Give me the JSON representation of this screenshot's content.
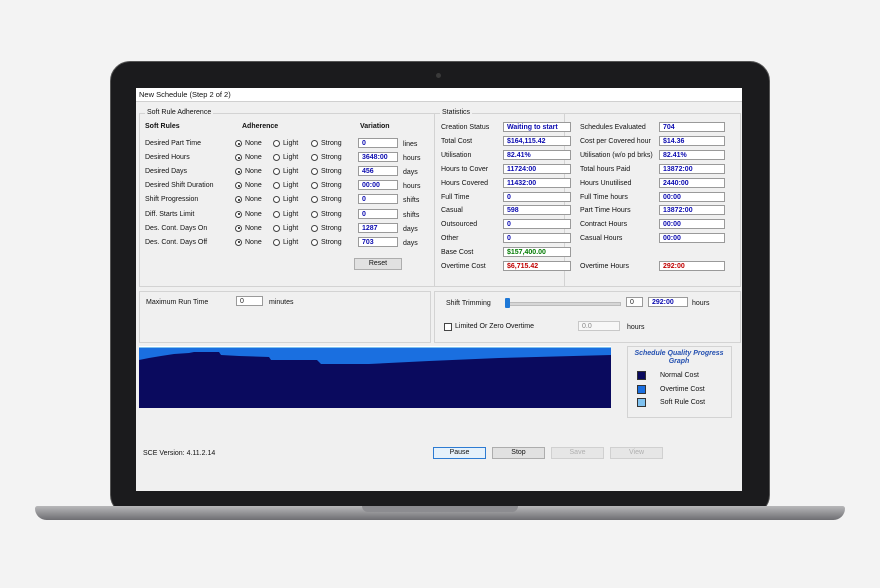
{
  "window": {
    "title": "New Schedule (Step 2 of 2)"
  },
  "soft_rules": {
    "group_title": "Soft Rule Adherence",
    "col_rules": "Soft Rules",
    "col_adherence": "Adherence",
    "col_variation": "Variation",
    "options": [
      "None",
      "Light",
      "Strong"
    ],
    "rows": [
      {
        "label": "Desired Part Time",
        "value": "0",
        "unit": "lines"
      },
      {
        "label": "Desired Hours",
        "value": "3648:00",
        "unit": "hours"
      },
      {
        "label": "Desired Days",
        "value": "456",
        "unit": "days"
      },
      {
        "label": "Desired Shift Duration",
        "value": "00:00",
        "unit": "hours"
      },
      {
        "label": "Shift Progression",
        "value": "0",
        "unit": "shifts"
      },
      {
        "label": "Diff. Starts Limit",
        "value": "0",
        "unit": "shifts"
      },
      {
        "label": "Des. Cont. Days On",
        "value": "1287",
        "unit": "days"
      },
      {
        "label": "Des. Cont. Days Off",
        "value": "703",
        "unit": "days"
      }
    ],
    "reset_label": "Reset"
  },
  "statistics": {
    "group_title": "Statistics",
    "left": [
      {
        "label": "Creation Status",
        "value": "Waiting to start"
      },
      {
        "label": "Total Cost",
        "value": "$164,115.42"
      },
      {
        "label": "Utilisation",
        "value": "82.41%"
      },
      {
        "label": "Hours to Cover",
        "value": "11724:00"
      },
      {
        "label": "Hours Covered",
        "value": "11432:00"
      },
      {
        "label": "Full Time",
        "value": "0"
      },
      {
        "label": "Casual",
        "value": "598"
      },
      {
        "label": "Outsourced",
        "value": "0"
      },
      {
        "label": "Other",
        "value": "0"
      },
      {
        "label": "Base Cost",
        "value": "$157,400.00"
      },
      {
        "label": "Overtime Cost",
        "value": "$6,715.42"
      }
    ],
    "right": [
      {
        "label": "Schedules Evaluated",
        "value": "704"
      },
      {
        "label": "Cost per Covered hour",
        "value": "$14.36"
      },
      {
        "label": "Utilisation (w/o pd brks)",
        "value": "82.41%"
      },
      {
        "label": "Total hours Paid",
        "value": "13872:00"
      },
      {
        "label": "Hours Unutilised",
        "value": "2440:00"
      },
      {
        "label": "Full Time hours",
        "value": "00:00"
      },
      {
        "label": "Part Time Hours",
        "value": "13872:00"
      },
      {
        "label": "Contract Hours",
        "value": "00:00"
      },
      {
        "label": "Casual Hours",
        "value": "00:00"
      },
      {
        "label": "Overtime Hours",
        "value": "292:00"
      }
    ]
  },
  "run_time": {
    "label": "Maximum Run Time",
    "value": "0",
    "unit": "minutes"
  },
  "trimming": {
    "label": "Shift Trimming",
    "slider_value": "0",
    "hours_value": "292:00",
    "hours_unit": "hours",
    "checkbox_label": "Limited Or Zero Overtime",
    "overtime_value": "0.0",
    "overtime_unit": "hours"
  },
  "graph": {
    "legend_title": "Schedule Quality Progress Graph",
    "legend": [
      {
        "label": "Normal Cost",
        "color": "#0a0a5e"
      },
      {
        "label": "Overtime Cost",
        "color": "#1a6fe0"
      },
      {
        "label": "Soft Rule Cost",
        "color": "#7fc2f0"
      }
    ]
  },
  "footer": {
    "version": "SCE Version: 4.11.2.14",
    "pause": "Pause",
    "stop": "Stop",
    "save": "Save",
    "view": "View"
  }
}
